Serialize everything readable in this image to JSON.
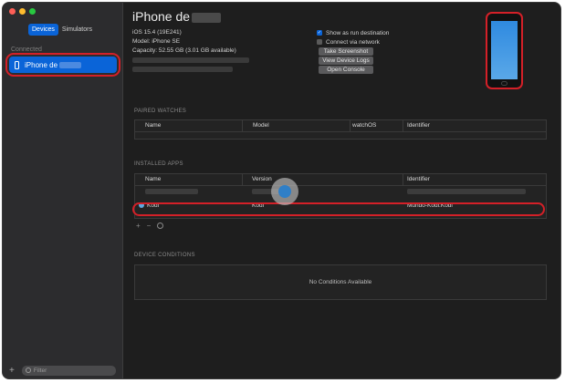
{
  "window": {
    "traffic_lights": [
      "#fe5f57",
      "#febc2e",
      "#28c840"
    ]
  },
  "sidebar": {
    "tabs": [
      {
        "label": "Devices",
        "active": true
      },
      {
        "label": "Simulators",
        "active": false
      }
    ],
    "section_label": "Connected",
    "device": {
      "name": "iPhone de",
      "selected": true
    },
    "filter_placeholder": "Filter",
    "add_symbol": "+"
  },
  "device": {
    "title": "iPhone de",
    "ios": "iOS 15.4 (19E241)",
    "model": "Model: iPhone SE",
    "capacity": "Capacity: 52.55 GB (3.01 GB available)",
    "options": {
      "show_as_run_destination": {
        "label": "Show as run destination",
        "checked": true
      },
      "connect_via_network": {
        "label": "Connect via network",
        "checked": false
      }
    },
    "buttons": {
      "screenshot": "Take Screenshot",
      "logs": "View Device Logs",
      "console": "Open Console"
    }
  },
  "paired_watches": {
    "heading": "PAIRED WATCHES",
    "columns": [
      "Name",
      "Model",
      "watchOS",
      "Identifier"
    ]
  },
  "installed_apps": {
    "heading": "INSTALLED APPS",
    "columns": [
      "Name",
      "Version",
      "Identifier"
    ],
    "rows": [
      {
        "name": "Kodi",
        "version": "Kodi",
        "identifier": "Mundo-Kodi.Kodi",
        "icon": "kodi-icon"
      }
    ],
    "tool_add": "+",
    "tool_remove": "−"
  },
  "device_conditions": {
    "heading": "DEVICE CONDITIONS",
    "empty_text": "No Conditions Available"
  },
  "colors": {
    "accent": "#0a64d8",
    "highlight_red": "#d42028"
  }
}
